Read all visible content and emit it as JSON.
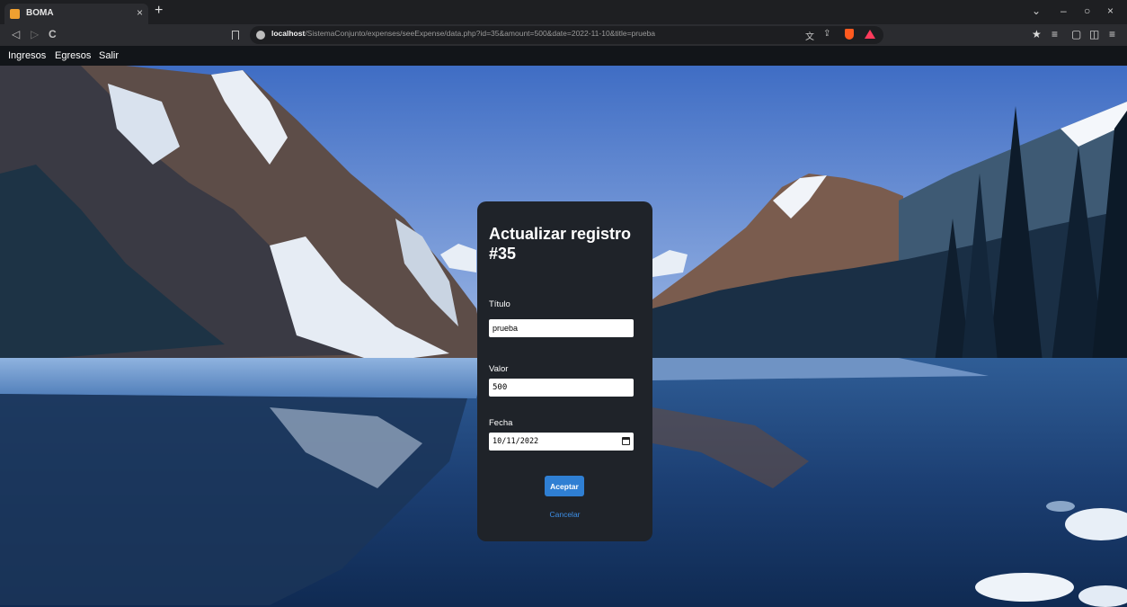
{
  "browser": {
    "tab_title": "BOMA",
    "tab_close": "×",
    "new_tab": "+",
    "nav": {
      "back": "◁",
      "forward": "▷",
      "reload": "C"
    },
    "bookmark_icon": "bookmark-icon",
    "url_host": "localhost",
    "url_path": "/SistemaConjunto/expenses/seeExpense/data.php?id=35&amount=500&date=2022-11-10&title=prueba",
    "window_controls": {
      "minimize": "–",
      "restore": "○",
      "close": "×",
      "menu_chevron": "⌄"
    },
    "extensions": [
      "★",
      "≡",
      "▢",
      "◫",
      "≡"
    ]
  },
  "app_nav": {
    "items": [
      "Ingresos",
      "Egresos",
      "Salir"
    ]
  },
  "form": {
    "title": "Actualizar registro #35",
    "title_label": "Título",
    "title_value": "prueba",
    "amount_label": "Valor",
    "amount_value": "500",
    "date_label": "Fecha",
    "date_value": "10/11/2022",
    "accept_label": "Aceptar",
    "cancel_label": "Cancelar"
  },
  "colors": {
    "card_bg": "#1f2329",
    "accent": "#2f7fd3",
    "link": "#3d8fe6",
    "nav_bg": "#121519"
  }
}
